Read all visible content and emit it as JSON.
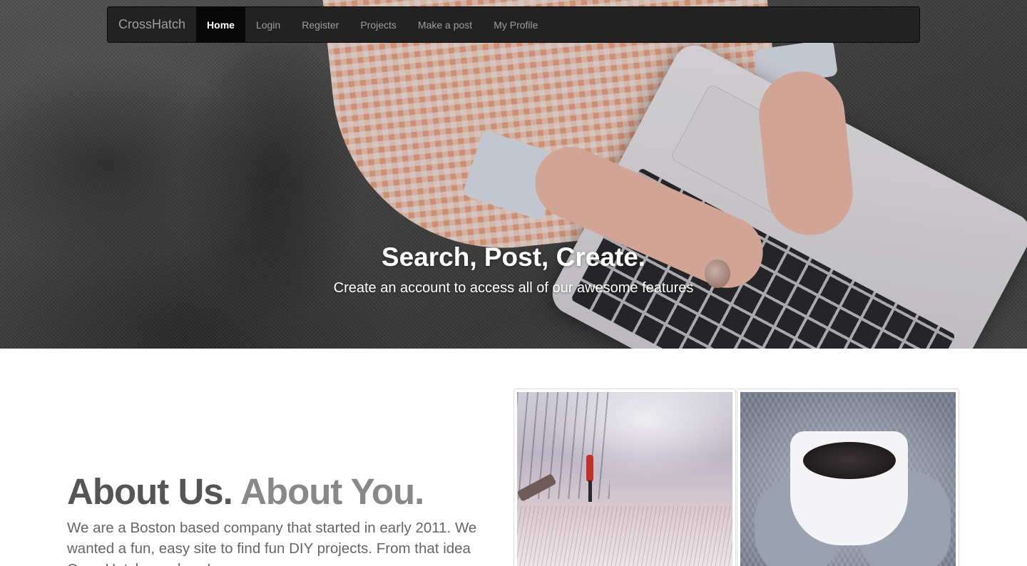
{
  "navbar": {
    "brand": "CrossHatch",
    "items": [
      {
        "label": "Home",
        "active": true
      },
      {
        "label": "Login",
        "active": false
      },
      {
        "label": "Register",
        "active": false
      },
      {
        "label": "Projects",
        "active": false
      },
      {
        "label": "Make a post",
        "active": false
      },
      {
        "label": "My Profile",
        "active": false
      }
    ]
  },
  "hero": {
    "title": "Search, Post, Create.",
    "subtitle": "Create an account to access all of our awesome features"
  },
  "about": {
    "title_part1": "About Us.",
    "title_part2": "About You.",
    "text": "We are a Boston based company that started in early 2011. We wanted a fun, easy site to find fun DIY projects. From that idea CrossHatch was born!"
  },
  "colors": {
    "navbar_bg": "#222222",
    "navbar_active_bg": "#080808",
    "nav_text": "#9d9d9d",
    "heading_text": "#555555"
  }
}
